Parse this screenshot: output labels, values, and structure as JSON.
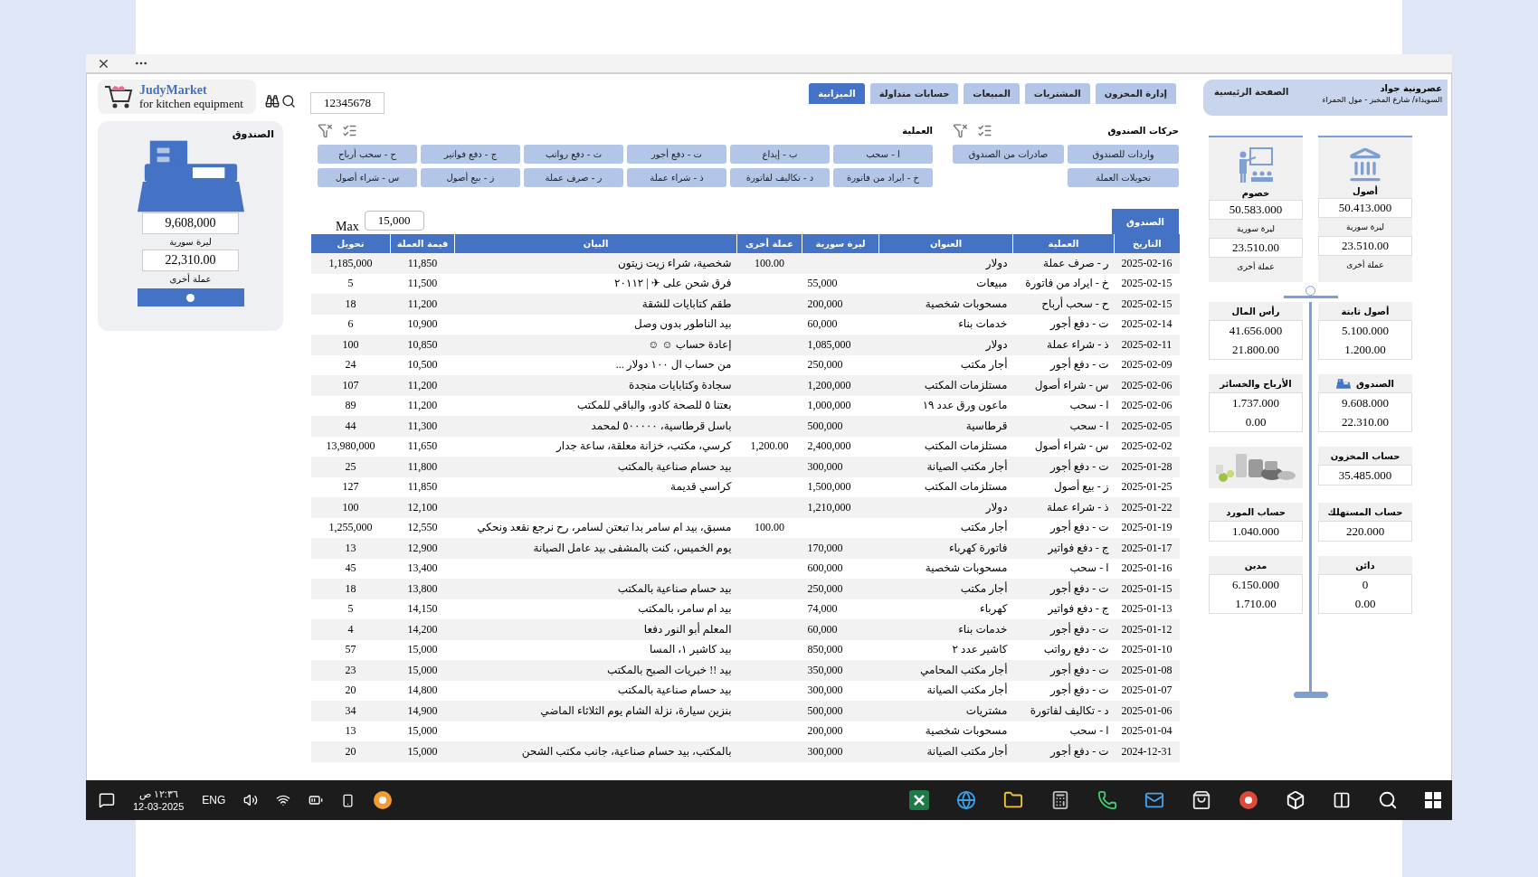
{
  "logo": {
    "name": "JudyMarket",
    "tagline": "for kitchen equipment"
  },
  "search": {
    "value": "12345678"
  },
  "cash_card": {
    "title": "الصندوق",
    "syp": "9,608,000",
    "syp_label": "ليرة سورية",
    "other": "22,310.00",
    "other_label": "عملة أخرى"
  },
  "tabs": [
    {
      "label": "إدارة المخزون",
      "selected": false
    },
    {
      "label": "المشتريات",
      "selected": false
    },
    {
      "label": "المبيعات",
      "selected": false
    },
    {
      "label": "حسابات متداولة",
      "selected": false
    },
    {
      "label": "الميزانية",
      "selected": true
    }
  ],
  "company": {
    "name": "عصرونية جواد",
    "address": "السويداء/ شارع المخبز - مول الحمراء",
    "home": "الصفحة الرئيسية"
  },
  "cash_filters": {
    "title": "حركات الصندوق",
    "buttons": [
      "واردات للصندوق",
      "صادرات من الصندوق",
      "تحويلات العملة"
    ]
  },
  "operation_filters": {
    "title": "العملية",
    "buttons": [
      "ا - سحب",
      "ب - إيداع",
      "ت - دفع أجور",
      "ث - دفع رواتب",
      "ج - دفع فواتير",
      "ح - سحب أرباح",
      "خ - ايراد من فاتورة",
      "د - تكاليف لفاتورة",
      "ذ - شراء عملة",
      "ر - صرف عملة",
      "ز - بيع أصول",
      "س - شراء أصول"
    ]
  },
  "table_tab": "الصندوق",
  "max": {
    "label": "Max",
    "value": "15,000"
  },
  "table": {
    "columns": [
      "التاريخ",
      "العملية",
      "العنوان",
      "ليرة سورية",
      "عملة أخرى",
      "البيان",
      "قيمة العملة",
      "تحويل"
    ],
    "rows": [
      [
        "2025-02-16",
        "ر - صرف عملة",
        "دولار",
        "",
        "100.00",
        "شخصية، شراء زيت زيتون",
        "11,850",
        "1,185,000"
      ],
      [
        "2025-02-15",
        "خ - ايراد من فاتورة",
        "مبيعات",
        "55,000",
        "",
        "فرق شحن على ✈ | ٢٠١١٢",
        "11,500",
        "5"
      ],
      [
        "2025-02-15",
        "ح - سحب أرباح",
        "مسحوبات شخصية",
        "200,000",
        "",
        "طقم كتابايات للشقة",
        "11,200",
        "18"
      ],
      [
        "2025-02-14",
        "ت - دفع أجور",
        "خدمات بناء",
        "60,000",
        "",
        "بيد الناطور بدون وصل",
        "10,900",
        "6"
      ],
      [
        "2025-02-11",
        "ذ - شراء عملة",
        "دولار",
        "1,085,000",
        "",
        "إعادة حساب ☺ ☺",
        "10,850",
        "100"
      ],
      [
        "2025-02-09",
        "ت - دفع أجور",
        "أجار مكتب",
        "250,000",
        "",
        "من حساب ال ١٠٠ دولار ...",
        "10,500",
        "24"
      ],
      [
        "2025-02-06",
        "س - شراء أصول",
        "مستلزمات المكتب",
        "1,200,000",
        "",
        "سجادة وكتابايات منجدة",
        "11,200",
        "107"
      ],
      [
        "2025-02-06",
        "ا - سحب",
        "ماعون ورق عدد ١٩",
        "1,000,000",
        "",
        "بعتنا ٥ للصحة كادو، والباقي للمكتب",
        "11,200",
        "89"
      ],
      [
        "2025-02-05",
        "ا - سحب",
        "قرطاسية",
        "500,000",
        "",
        "باسل قرطاسية، ٥٠٠٠٠٠ لمحمد",
        "11,300",
        "44"
      ],
      [
        "2025-02-02",
        "س - شراء أصول",
        "مستلزمات المكتب",
        "2,400,000",
        "1,200.00",
        "كرسي، مكتب، خزانة معلقة، ساعة جدار",
        "11,650",
        "13,980,000"
      ],
      [
        "2025-01-28",
        "ت - دفع أجور",
        "أجار مكتب الصيانة",
        "300,000",
        "",
        "بيد حسام صناعية بالمكتب",
        "11,800",
        "25"
      ],
      [
        "2025-01-25",
        "ز - بيع أصول",
        "مستلزمات المكتب",
        "1,500,000",
        "",
        "كراسي قديمة",
        "11,850",
        "127"
      ],
      [
        "2025-01-22",
        "ذ - شراء عملة",
        "دولار",
        "1,210,000",
        "",
        "",
        "12,100",
        "100"
      ],
      [
        "2025-01-19",
        "ت - دفع أجور",
        "أجار مكتب",
        "",
        "100.00",
        "مسبق، بيد ام سامر بدا تبعتن لسامر، رح نرجع نقعد ونحكي",
        "12,550",
        "1,255,000"
      ],
      [
        "2025-01-17",
        "ج - دفع فواتير",
        "فاتورة كهرباء",
        "170,000",
        "",
        "يوم الخميس، كنت بالمشفى بيد عامل الصيانة",
        "12,900",
        "13"
      ],
      [
        "2025-01-16",
        "ا - سحب",
        "مسحوبات شخصية",
        "600,000",
        "",
        "",
        "13,400",
        "45"
      ],
      [
        "2025-01-15",
        "ت - دفع أجور",
        "أجار مكتب",
        "250,000",
        "",
        "بيد حسام صناعية بالمكتب",
        "13,800",
        "18"
      ],
      [
        "2025-01-13",
        "ج - دفع فواتير",
        "كهرباء",
        "74,000",
        "",
        "بيد ام سامر، بالمكتب",
        "14,150",
        "5"
      ],
      [
        "2025-01-12",
        "ت - دفع أجور",
        "خدمات بناء",
        "60,000",
        "",
        "المعلم أبو النور دفعا",
        "14,200",
        "4"
      ],
      [
        "2025-01-10",
        "ث - دفع رواتب",
        "كاشير عدد ٢",
        "850,000",
        "",
        "بيد كاشير ١، المسا",
        "15,000",
        "57"
      ],
      [
        "2025-01-08",
        "ت - دفع أجور",
        "أجار مكتب المحامي",
        "350,000",
        "",
        "بيد !! خبريات الصبح بالمكتب",
        "15,000",
        "23"
      ],
      [
        "2025-01-07",
        "ت - دفع أجور",
        "أجار مكتب الصيانة",
        "300,000",
        "",
        "بيد حسام صناعية بالمكتب",
        "14,800",
        "20"
      ],
      [
        "2025-01-06",
        "د - تكاليف لفاتورة",
        "مشتريات",
        "500,000",
        "",
        "بنزين سيارة، نزلة الشام يوم الثلاثاء الماضي",
        "14,900",
        "34"
      ],
      [
        "2025-01-04",
        "ا - سحب",
        "مسحوبات شخصية",
        "200,000",
        "",
        "",
        "15,000",
        "13"
      ],
      [
        "2024-12-31",
        "ت - دفع أجور",
        "أجار مكتب الصيانة",
        "300,000",
        "",
        "بالمكتب، بيد حسام صناعية، جانب مكتب الشحن",
        "15,000",
        "20"
      ]
    ]
  },
  "summary": {
    "top": [
      {
        "title": "أصول",
        "syp": "50.413.000",
        "syp_label": "ليرة سورية",
        "other": "23.510.00",
        "other_label": "عملة أخرى"
      },
      {
        "title": "خصوم",
        "syp": "50.583.000",
        "syp_label": "ليرة سورية",
        "other": "23.510.00",
        "other_label": "عملة أخرى"
      }
    ],
    "pairs": [
      [
        {
          "kind": "values",
          "title": "أصول ثابتة",
          "values": [
            "5.100.000",
            "1.200.00"
          ]
        },
        {
          "kind": "values",
          "title": "رأس المال",
          "values": [
            "41.656.000",
            "21.800.00"
          ]
        }
      ],
      [
        {
          "kind": "icon_values",
          "title": "الصندوق",
          "values": [
            "9.608.000",
            "22.310.00"
          ]
        },
        {
          "kind": "values",
          "title": "الأرباح والخسائر",
          "values": [
            "1.737.000",
            "0.00"
          ]
        }
      ],
      [
        {
          "kind": "values",
          "title": "حساب المخزون",
          "values": [
            "35.485.000"
          ]
        },
        {
          "kind": "picture"
        }
      ],
      [
        {
          "kind": "values",
          "title": "حساب المستهلك",
          "values": [
            "220.000"
          ]
        },
        {
          "kind": "values",
          "title": "حساب المورد",
          "values": [
            "1.040.000"
          ]
        }
      ],
      [
        {
          "kind": "values",
          "title": "دائن",
          "values": [
            "0",
            "0.00"
          ]
        },
        {
          "kind": "values",
          "title": "مدين",
          "values": [
            "6.150.000",
            "1.710.00"
          ]
        }
      ]
    ]
  },
  "taskbar": {
    "time": "١٢:٣٦ ص",
    "date": "12-03-2025",
    "language": "ENG"
  }
}
